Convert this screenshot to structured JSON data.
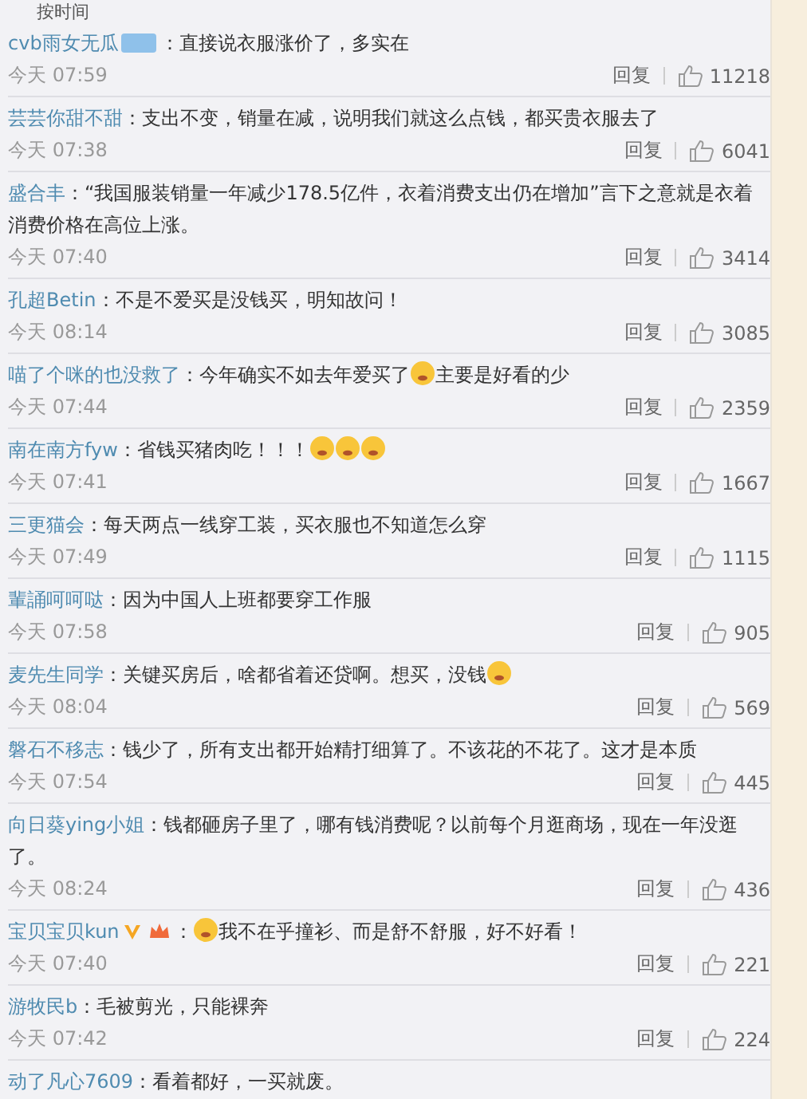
{
  "sort_label": "按时间",
  "comments": [
    {
      "name": "cvb雨女无瓜",
      "badges": [
        {
          "kind": "level"
        }
      ],
      "content": [
        {
          "kind": "text",
          "text": "：直接说衣服涨价了，多实在"
        }
      ],
      "time": "今天 07:59",
      "reply": "回复",
      "likes": "11218"
    },
    {
      "name": "芸芸你甜不甜",
      "content": [
        {
          "kind": "text",
          "text": "：支出不变，销量在减，说明我们就这么点钱，都买贵衣服去了"
        }
      ],
      "time": "今天 07:38",
      "reply": "回复",
      "likes": "6041"
    },
    {
      "name": "盛合丰",
      "content": [
        {
          "kind": "text",
          "text": "：“我国服装销量一年减少178.5亿件，衣着消费支出仍在增加”言下之意就是衣着消费价格在高位上涨。"
        }
      ],
      "time": "今天 07:40",
      "reply": "回复",
      "likes": "3414"
    },
    {
      "name": "孔超Betin",
      "content": [
        {
          "kind": "text",
          "text": "：不是不爱买是没钱买，明知故问！"
        }
      ],
      "time": "今天 08:14",
      "reply": "回复",
      "likes": "3085"
    },
    {
      "name": "喵了个咪的也没救了",
      "content": [
        {
          "kind": "text",
          "text": "：今年确实不如去年爱买了"
        },
        {
          "kind": "emoji"
        },
        {
          "kind": "text",
          "text": "主要是好看的少"
        }
      ],
      "time": "今天 07:44",
      "reply": "回复",
      "likes": "2359"
    },
    {
      "name": "南在南方fyw",
      "content": [
        {
          "kind": "text",
          "text": "：省钱买猪肉吃！！！"
        },
        {
          "kind": "emoji"
        },
        {
          "kind": "emoji"
        },
        {
          "kind": "emoji"
        }
      ],
      "time": "今天 07:41",
      "reply": "回复",
      "likes": "1667"
    },
    {
      "name": "三更猫会",
      "content": [
        {
          "kind": "text",
          "text": "：每天两点一线穿工装，买衣服也不知道怎么穿"
        }
      ],
      "time": "今天 07:49",
      "reply": "回复",
      "likes": "1115"
    },
    {
      "name": "輩誦呵呵哒",
      "content": [
        {
          "kind": "text",
          "text": "：因为中国人上班都要穿工作服"
        }
      ],
      "time": "今天 07:58",
      "reply": "回复",
      "likes": "905"
    },
    {
      "name": "麦先生同学",
      "content": [
        {
          "kind": "text",
          "text": "：关键买房后，啥都省着还贷啊。想买，没钱"
        },
        {
          "kind": "emoji"
        }
      ],
      "time": "今天 08:04",
      "reply": "回复",
      "likes": "569"
    },
    {
      "name": "磐石不移志",
      "content": [
        {
          "kind": "text",
          "text": "：钱少了，所有支出都开始精打细算了。不该花的不花了。这才是本质"
        }
      ],
      "time": "今天 07:54",
      "reply": "回复",
      "likes": "445"
    },
    {
      "name": "向日葵ying小姐",
      "content": [
        {
          "kind": "text",
          "text": "：钱都砸房子里了，哪有钱消费呢？以前每个月逛商场，现在一年没逛了。"
        }
      ],
      "time": "今天 08:24",
      "reply": "回复",
      "likes": "436"
    },
    {
      "name": "宝贝宝贝kun",
      "badges": [
        {
          "kind": "verified"
        },
        {
          "kind": "crown"
        }
      ],
      "content": [
        {
          "kind": "text",
          "text": "："
        },
        {
          "kind": "emoji"
        },
        {
          "kind": "text",
          "text": "我不在乎撞衫、而是舒不舒服，好不好看！"
        }
      ],
      "time": "今天 07:40",
      "reply": "回复",
      "likes": "221"
    },
    {
      "name": "游牧民b",
      "content": [
        {
          "kind": "text",
          "text": "：毛被剪光，只能裸奔"
        }
      ],
      "time": "今天 07:42",
      "reply": "回复",
      "likes": "224"
    },
    {
      "name": "动了凡心7609",
      "content": [
        {
          "kind": "text",
          "text": "：看着都好，一买就废。"
        }
      ]
    }
  ]
}
